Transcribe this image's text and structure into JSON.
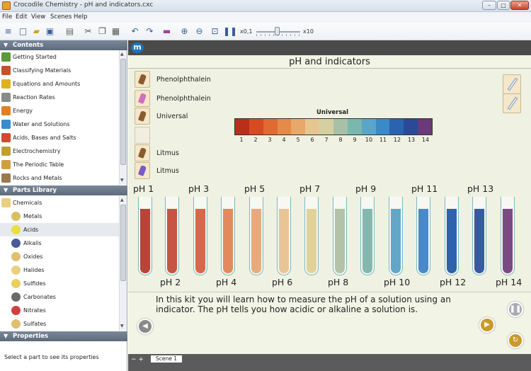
{
  "window": {
    "title": "Crocodile Chemistry - pH and indicators.cxc"
  },
  "menu": [
    "File",
    "Edit",
    "View",
    "Scenes",
    "Help"
  ],
  "toolbar": {
    "speed_min": "x0,1",
    "speed_max": "x10"
  },
  "sidebar": {
    "contents_title": "Contents",
    "contents": [
      {
        "label": "Getting Started",
        "color": "#5a9a3a"
      },
      {
        "label": "Classifying Materials",
        "color": "#c8502a"
      },
      {
        "label": "Equations and Amounts",
        "color": "#e0b020"
      },
      {
        "label": "Reaction Rates",
        "color": "#8a8a8a"
      },
      {
        "label": "Energy",
        "color": "#e08020"
      },
      {
        "label": "Water and Solutions",
        "color": "#3a8ad0"
      },
      {
        "label": "Acids, Bases and Salts",
        "color": "#d04a30"
      },
      {
        "label": "Electrochemistry",
        "color": "#c0a030"
      },
      {
        "label": "The Periodic Table",
        "color": "#d0a040"
      },
      {
        "label": "Rocks and Metals",
        "color": "#9a7a50"
      }
    ],
    "parts_title": "Parts Library",
    "parts_root": "Chemicals",
    "parts": [
      {
        "label": "Metals",
        "color": "#d8c060"
      },
      {
        "label": "Acids",
        "color": "#e8e040"
      },
      {
        "label": "Alkalis",
        "color": "#4a5a9a"
      },
      {
        "label": "Oxides",
        "color": "#e0c070"
      },
      {
        "label": "Halides",
        "color": "#e8d080"
      },
      {
        "label": "Sulfides",
        "color": "#e8d060"
      },
      {
        "label": "Carbonates",
        "color": "#6a6a6a"
      },
      {
        "label": "Nitrates",
        "color": "#d04040"
      },
      {
        "label": "Sulfates",
        "color": "#e0c070"
      }
    ],
    "selected_part": "Acids",
    "properties_title": "Properties",
    "properties_text": "Select a part to see its properties"
  },
  "main": {
    "title": "pH and indicators",
    "indicators": [
      {
        "label": "Phenolphthalein",
        "color": "#8a5a30"
      },
      {
        "label": "Phenolphthalein",
        "color": "#d070c0"
      },
      {
        "label": "Universal",
        "color": "#8a5a30"
      },
      {
        "label": "Litmus",
        "color": "#8a5a30"
      },
      {
        "label": "Litmus",
        "color": "#7a5ac8"
      }
    ],
    "chart_title": "Universal",
    "scale": [
      {
        "ph": "1",
        "color": "#b8301c"
      },
      {
        "ph": "2",
        "color": "#d84a20"
      },
      {
        "ph": "3",
        "color": "#e06a30"
      },
      {
        "ph": "4",
        "color": "#e68a4a"
      },
      {
        "ph": "5",
        "color": "#e8a86a"
      },
      {
        "ph": "6",
        "color": "#e6c690"
      },
      {
        "ph": "7",
        "color": "#d6d0a0"
      },
      {
        "ph": "8",
        "color": "#a8c0a8"
      },
      {
        "ph": "9",
        "color": "#7ab8ae"
      },
      {
        "ph": "10",
        "color": "#5aa6c8"
      },
      {
        "ph": "11",
        "color": "#3a8ac8"
      },
      {
        "ph": "12",
        "color": "#2a64b0"
      },
      {
        "ph": "13",
        "color": "#2a4a98"
      },
      {
        "ph": "14",
        "color": "#6a3a7a"
      }
    ],
    "tubes": [
      {
        "label": "pH 1",
        "color": "#b8443a"
      },
      {
        "label": "pH 2",
        "color": "#c65544"
      },
      {
        "label": "pH 3",
        "color": "#d8684a"
      },
      {
        "label": "pH 4",
        "color": "#e28a5e"
      },
      {
        "label": "pH 5",
        "color": "#e8aa7c"
      },
      {
        "label": "pH 6",
        "color": "#e8c496"
      },
      {
        "label": "pH 7",
        "color": "#e2d29a"
      },
      {
        "label": "pH 8",
        "color": "#b4c2aa"
      },
      {
        "label": "pH 9",
        "color": "#84b8ae"
      },
      {
        "label": "pH 10",
        "color": "#62a6c8"
      },
      {
        "label": "pH 11",
        "color": "#4a88c8"
      },
      {
        "label": "pH 12",
        "color": "#2e62aa"
      },
      {
        "label": "pH 13",
        "color": "#3a5aa0"
      },
      {
        "label": "pH 14",
        "color": "#7a4a82"
      }
    ],
    "info_text": "In this kit you will learn how to measure the pH of a solution using an indicator. The pH tells you how acidic or alkaline a solution is.",
    "scene_ctrl": "− +",
    "scene_tab": "Scene 1"
  }
}
